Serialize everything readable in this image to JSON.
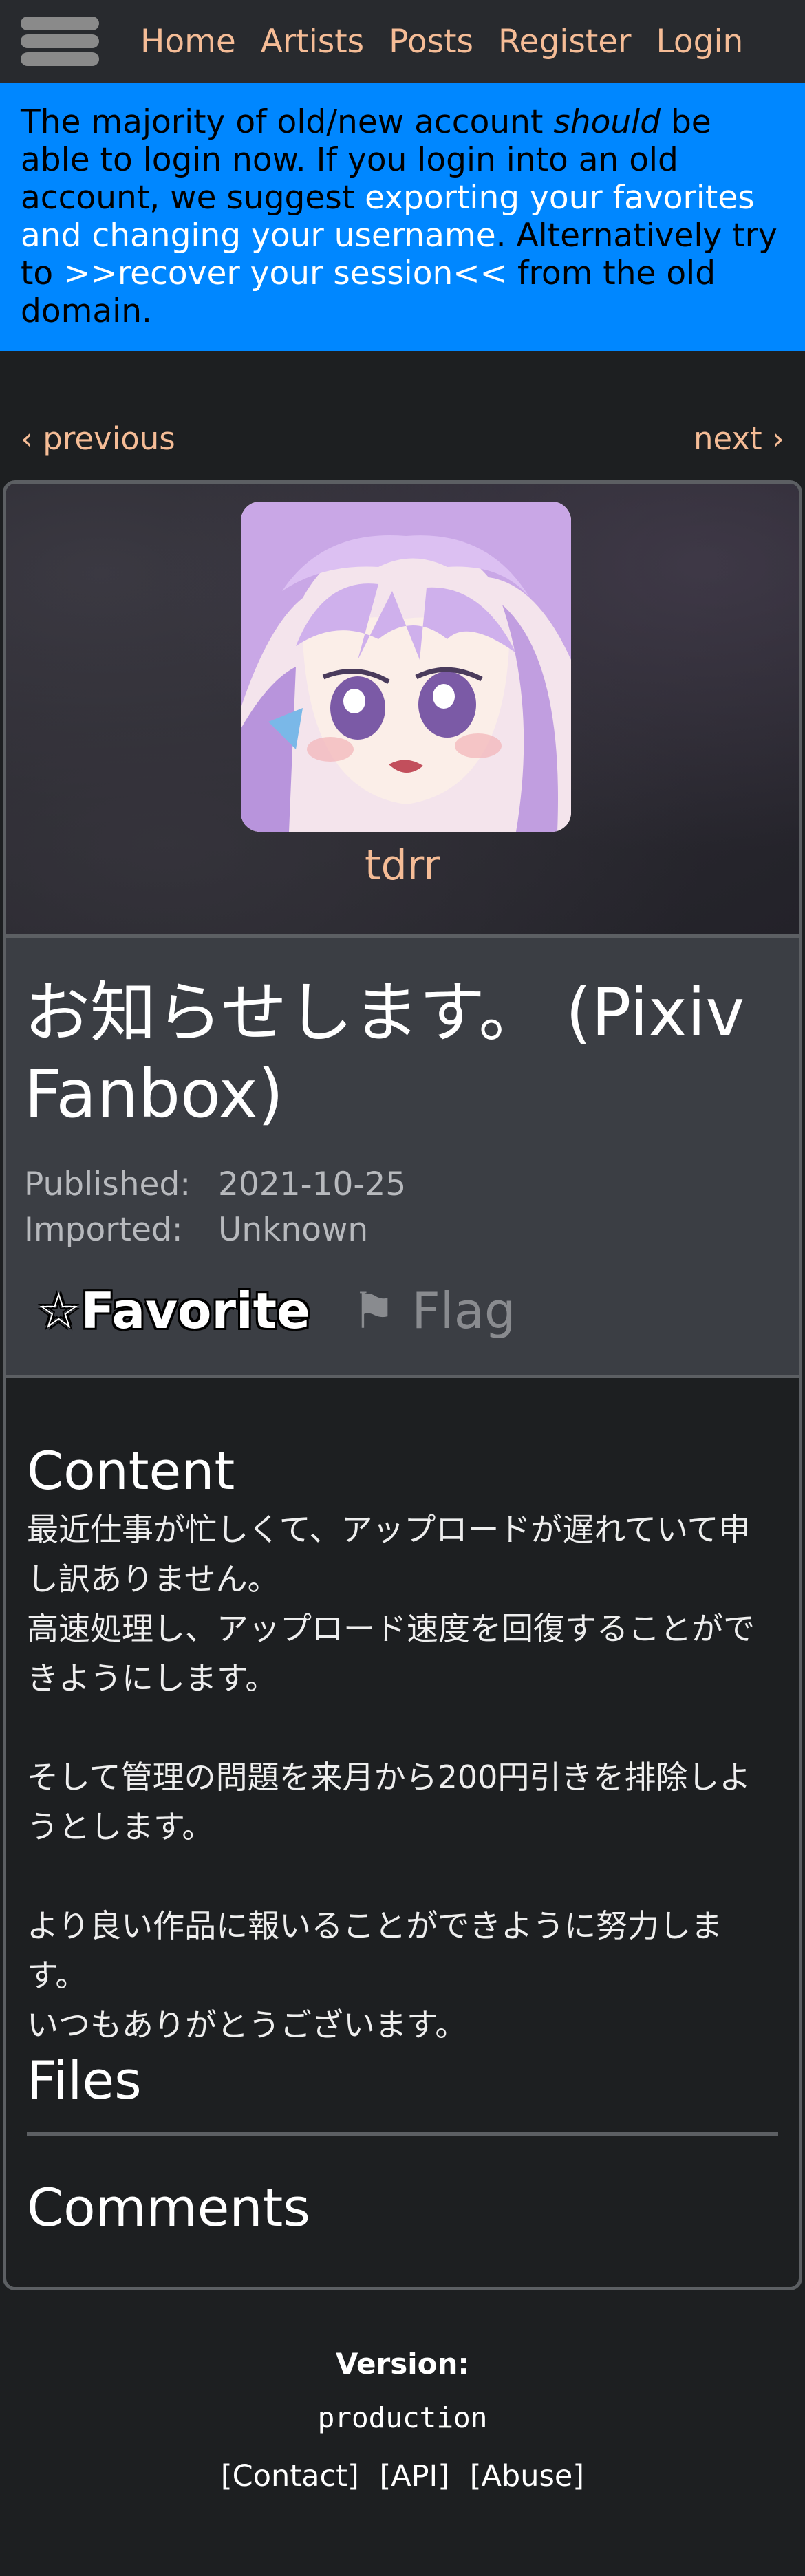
{
  "nav": {
    "links": [
      "Home",
      "Artists",
      "Posts",
      "Register",
      "Login"
    ]
  },
  "announcement": {
    "part1": "The majority of old/new account ",
    "emph": "should",
    "part2": " be able to login now. If you login into an old account, we suggest ",
    "link1": "exporting your favorites and changing your username",
    "part3": ". Alternatively try to ",
    "link2": ">>recover your session<<",
    "part4": " from the old domain."
  },
  "paginator": {
    "previous": "‹ previous",
    "next": "next ›"
  },
  "artist": {
    "name": "tdrr"
  },
  "post": {
    "title": "お知らせします。 (Pixiv Fanbox)",
    "published_label": "Published:",
    "published": "2021-10-25",
    "imported_label": "Imported:",
    "imported": "Unknown",
    "favorite": "☆Favorite",
    "flag": "⚑ Flag"
  },
  "content": {
    "heading": "Content",
    "lines": [
      "最近仕事が忙しくて、アップロードが遅れていて申し訳ありません。",
      "高速処理し、アップロード速度を回復することができようにします。",
      "",
      "そして管理の問題を来月から200円引きを排除しようとします。",
      "",
      "より良い作品に報いることができように努力します。",
      "いつもありがとうございます。"
    ]
  },
  "files": {
    "heading": "Files"
  },
  "comments": {
    "heading": "Comments"
  },
  "footer": {
    "version_label": "Version:",
    "version": "production",
    "links": [
      "[Contact]",
      "[API]",
      "[Abuse]"
    ]
  },
  "colors": {
    "accent": "#f5bc96",
    "announcement_bg": "#0087ff",
    "card_header_bg": "#3b3e44"
  }
}
